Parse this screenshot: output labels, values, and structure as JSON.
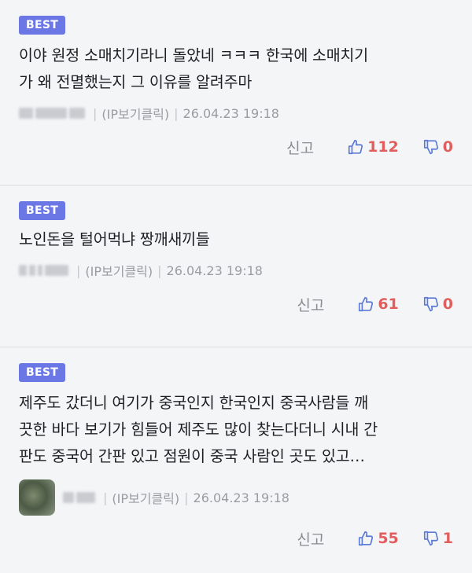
{
  "comments": [
    {
      "badge": "BEST",
      "text": "이야 원정 소매치기라니 돌았네 ㅋㅋㅋ 한국에 소매치기\n가 왜 전멸했는지 그 이유를 알려주마",
      "ip_label": "(IP보기클릭)",
      "datetime": "26.04.23 19:18",
      "report_label": "신고",
      "likes": "112",
      "dislikes": "0"
    },
    {
      "badge": "BEST",
      "text": "노인돈을 털어먹냐 짱깨새끼들",
      "ip_label": "(IP보기클릭)",
      "datetime": "26.04.23 19:18",
      "report_label": "신고",
      "likes": "61",
      "dislikes": "0"
    },
    {
      "badge": "BEST",
      "text": "제주도 갔더니 여기가 중국인지 한국인지 중국사람들 깨\n끗한 바다 보기가 힘들어 제주도 많이 찾는다더니 시내 간\n판도 중국어 간판 있고 점원이 중국 사람인 곳도 있고…",
      "ip_label": "(IP보기클릭)",
      "datetime": "26.04.23 19:18",
      "report_label": "신고",
      "likes": "55",
      "dislikes": "1"
    }
  ],
  "colors": {
    "badge": "#6b77e5",
    "vote_count": "#e25d5d",
    "vote_icon": "#5b79d6"
  },
  "icons": {
    "like": "thumbs-up-icon",
    "dislike": "thumbs-down-icon"
  }
}
